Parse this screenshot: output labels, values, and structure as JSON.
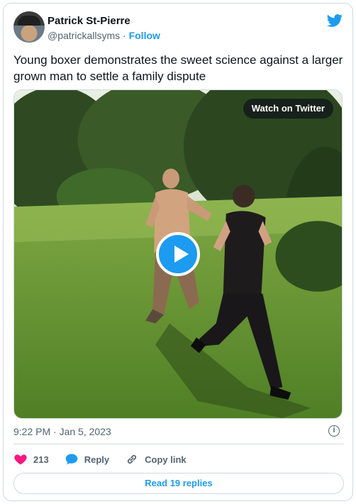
{
  "author": {
    "display_name": "Patrick St-Pierre",
    "handle": "@patrickallsyms",
    "separator": "·",
    "follow_label": "Follow"
  },
  "tweet": {
    "text": "Young boxer demonstrates the sweet science against a larger grown man to settle a family dispute",
    "timestamp": "9:22 PM · Jan 5, 2023"
  },
  "media": {
    "watch_label": "Watch on Twitter"
  },
  "actions": {
    "like_count": "213",
    "reply_label": "Reply",
    "copy_link_label": "Copy link"
  },
  "footer": {
    "read_replies_label": "Read 19 replies"
  },
  "colors": {
    "brand": "#1d9bf0",
    "like": "#f91880",
    "muted": "#536471",
    "border": "#cfd9de"
  }
}
